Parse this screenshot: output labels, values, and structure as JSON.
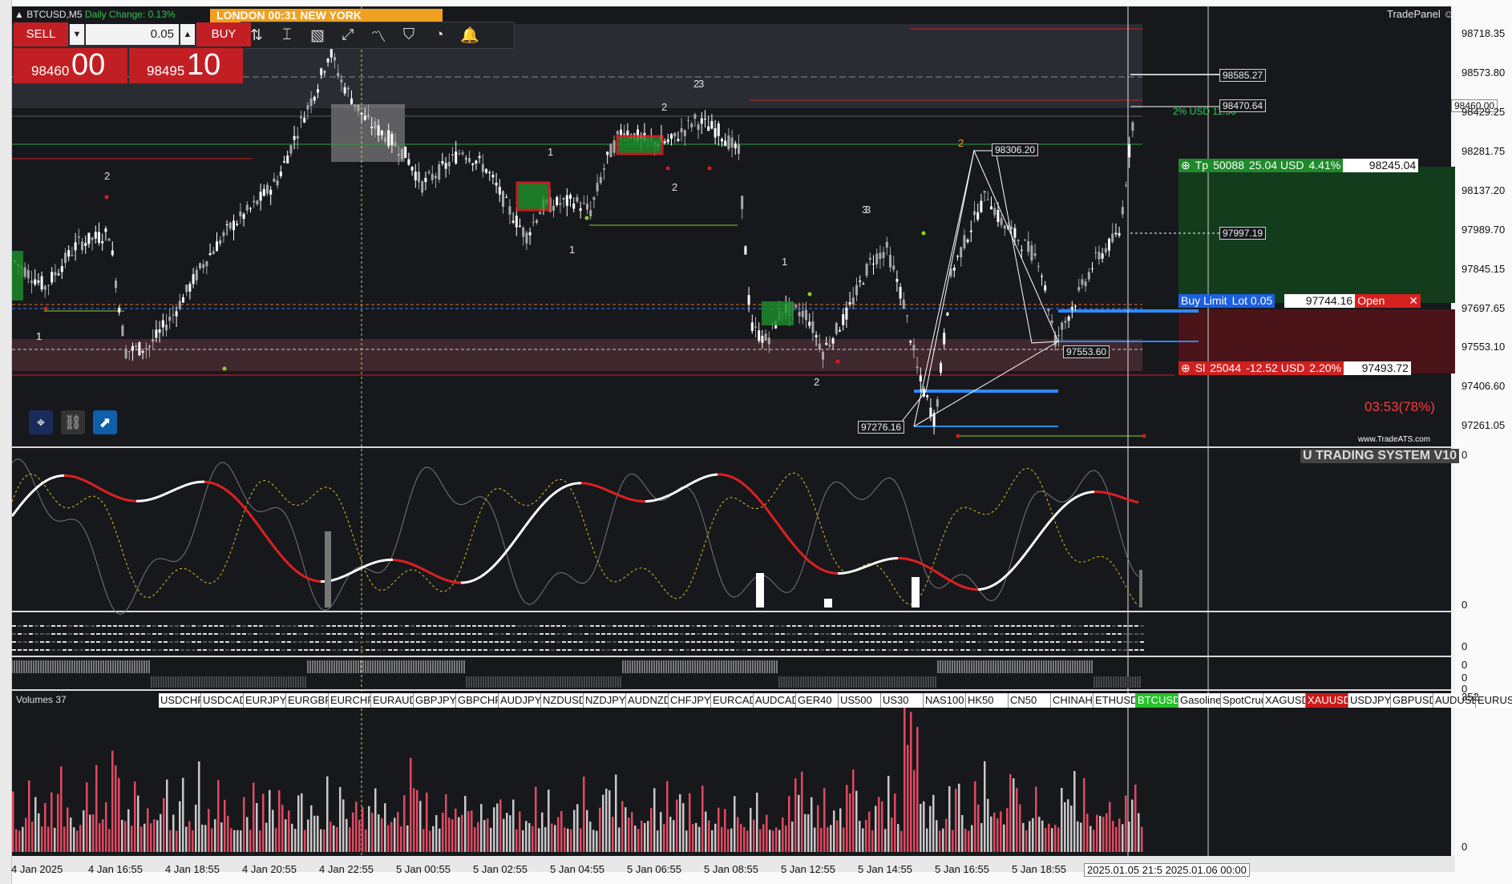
{
  "header": {
    "symbol": "BTCUSD,M5",
    "daily_change": "Daily Change: 0.13%",
    "session": "LONDON 00:31    NEW YORK",
    "tradepanel": "TradePanel"
  },
  "trade": {
    "sell_label": "SELL",
    "buy_label": "BUY",
    "lot": "0.05",
    "sell_main": "98460",
    "sell_big": "00",
    "buy_main": "98495",
    "buy_big": "10"
  },
  "levels": {
    "tp": {
      "label": "Tp",
      "points": "50088",
      "money": "25.04 USD",
      "pct": "4.41%",
      "price": "98245.04"
    },
    "order": {
      "label": "Buy Limit",
      "lot": "Lot 0.05",
      "price": "97744.16",
      "open": "Open"
    },
    "sl": {
      "label": "Sl",
      "points": "25044",
      "money": "-12.52 USD",
      "pct": "2.20%",
      "price": "97493.72"
    },
    "risk_label": "2% USD 11.56"
  },
  "tags": {
    "t1": "98585.27",
    "t2": "98470.64",
    "t3": "98306.20",
    "t4": "97997.19",
    "t5": "97553.60",
    "t6": "97276.16"
  },
  "axis": {
    "current": "98460.00",
    "prices": [
      "98718.35",
      "98573.80",
      "98429.25",
      "98281.75",
      "98137.20",
      "97989.70",
      "97845.15",
      "97697.65",
      "97553.10",
      "97406.60",
      "97261.05"
    ],
    "sub_labels": [
      "0",
      "0",
      "0",
      "0",
      "0",
      "0",
      "352",
      "0"
    ],
    "times": [
      "4 Jan 2025",
      "4 Jan 16:55",
      "4 Jan 18:55",
      "4 Jan 20:55",
      "4 Jan 22:55",
      "5 Jan 00:55",
      "5 Jan 02:55",
      "5 Jan 04:55",
      "5 Jan 06:55",
      "5 Jan 08:55",
      "5 Jan 12:55",
      "5 Jan 14:55",
      "5 Jan 16:55",
      "5 Jan 18:55"
    ],
    "time_box": "2025.01.05 21:5  2025.01.06 00:00"
  },
  "timer": "03:53(78%)",
  "indicator_title": "U TRADING SYSTEM V10",
  "watermark": "www.TradeATS.com",
  "volumes": {
    "label": "Volumes 37"
  },
  "symbols": [
    {
      "name": "USDCHF",
      "state": ""
    },
    {
      "name": "USDCAD",
      "state": ""
    },
    {
      "name": "EURJPY",
      "state": ""
    },
    {
      "name": "EURGBP",
      "state": ""
    },
    {
      "name": "EURCHF",
      "state": ""
    },
    {
      "name": "EURAUD",
      "state": ""
    },
    {
      "name": "GBPJPY",
      "state": ""
    },
    {
      "name": "GBPCHF",
      "state": ""
    },
    {
      "name": "AUDJPY",
      "state": ""
    },
    {
      "name": "NZDUSD",
      "state": ""
    },
    {
      "name": "NZDJPY",
      "state": ""
    },
    {
      "name": "AUDNZD",
      "state": ""
    },
    {
      "name": "CHFJPY",
      "state": ""
    },
    {
      "name": "EURCAD",
      "state": ""
    },
    {
      "name": "AUDCAD",
      "state": ""
    },
    {
      "name": "GER40",
      "state": ""
    },
    {
      "name": "US500",
      "state": ""
    },
    {
      "name": "US30",
      "state": ""
    },
    {
      "name": "NAS100",
      "state": ""
    },
    {
      "name": "HK50",
      "state": ""
    },
    {
      "name": "CN50",
      "state": ""
    },
    {
      "name": "CHINAH",
      "state": ""
    },
    {
      "name": "ETHUSD",
      "state": ""
    },
    {
      "name": "BTCUSD",
      "state": "active"
    },
    {
      "name": "Gasoline",
      "state": ""
    },
    {
      "name": "SpotCrude",
      "state": ""
    },
    {
      "name": "XAGUSD",
      "state": ""
    },
    {
      "name": "XAUUSD",
      "state": "red"
    },
    {
      "name": "USDJPY",
      "state": ""
    },
    {
      "name": "GBPUSD",
      "state": ""
    },
    {
      "name": "AUDUSD",
      "state": ""
    },
    {
      "name": "EURUSD",
      "state": ""
    }
  ],
  "wave_labels": [
    "2",
    "1",
    "3",
    "1",
    "2",
    "2",
    "1",
    "1",
    "2",
    "3",
    "1",
    "2",
    "2",
    "3"
  ],
  "colors": {
    "bg": "#17181c",
    "bull": "#ffffff",
    "bear": "#a8a8a8",
    "red": "#e02020",
    "green": "#2fd05a",
    "blue": "#2a8cff"
  }
}
